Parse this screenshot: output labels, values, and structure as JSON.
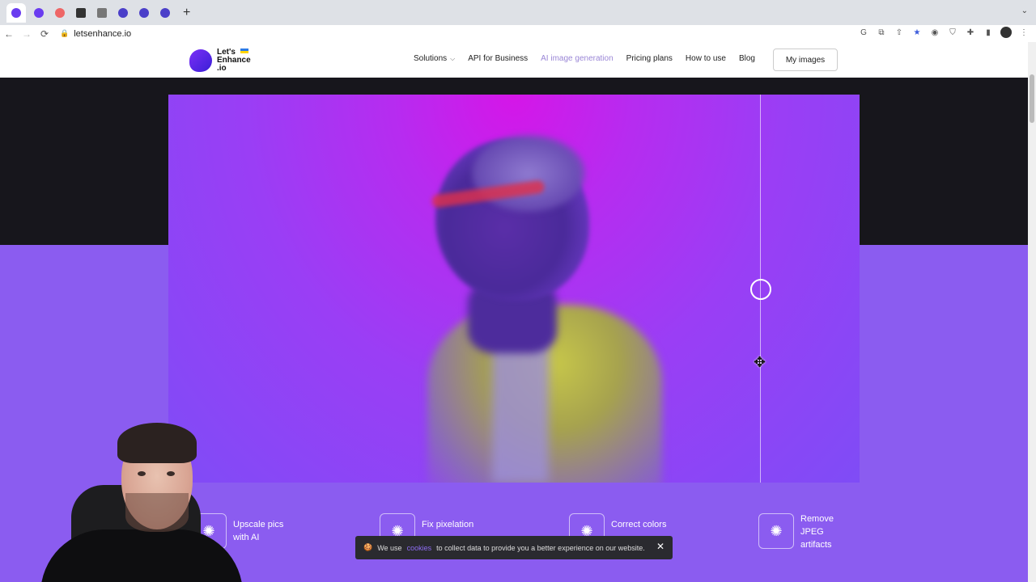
{
  "browser": {
    "url": "letsenhance.io",
    "tab_count": 8
  },
  "site": {
    "logo_text": "Let's\nEnhance\n.io",
    "nav": {
      "solutions": "Solutions",
      "api": "API for Business",
      "ai_image": "AI image generation",
      "pricing": "Pricing plans",
      "how_to": "How to use",
      "blog": "Blog"
    },
    "my_images": "My images"
  },
  "features": [
    {
      "label": "Upscale pics\nwith AI"
    },
    {
      "label": "Fix pixelation"
    },
    {
      "label": "Correct colors"
    },
    {
      "label": "Remove\nJPEG\nartifacts"
    }
  ],
  "cookie": {
    "prefix": "We use",
    "link": "cookies",
    "suffix": "to collect data to provide you a better experience on our website.",
    "close": "✕"
  },
  "colors": {
    "accent": "#8b5cf0",
    "dark": "#17161c"
  }
}
